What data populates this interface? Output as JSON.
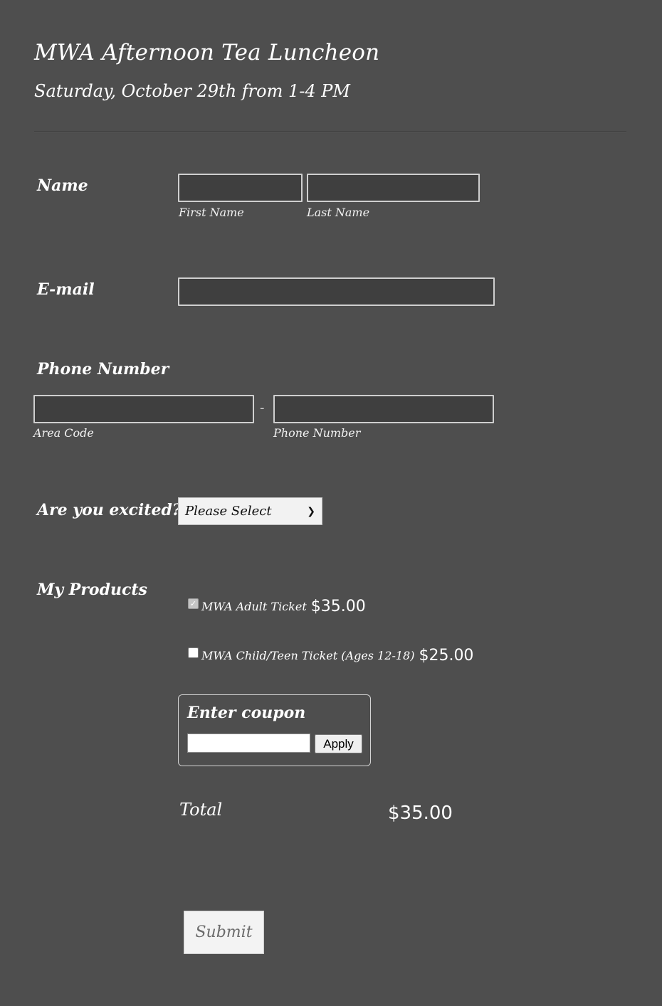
{
  "header": {
    "title": "MWA Afternoon Tea Luncheon",
    "subtitle": "Saturday, October 29th from 1-4 PM"
  },
  "name_field": {
    "label": "Name",
    "first_label": "First Name",
    "last_label": "Last Name",
    "first_value": "",
    "last_value": ""
  },
  "email_field": {
    "label": "E-mail",
    "value": ""
  },
  "phone_field": {
    "label": "Phone Number",
    "area_label": "Area Code",
    "number_label": "Phone Number",
    "separator": "-",
    "area_value": "",
    "number_value": ""
  },
  "excited_field": {
    "label": "Are you excited?",
    "selected": "Please Select"
  },
  "products": {
    "label": "My Products",
    "items": [
      {
        "name": "MWA Adult Ticket",
        "price": "$35.00",
        "checked": true
      },
      {
        "name": "MWA Child/Teen Ticket (Ages 12-18)",
        "price": "$25.00",
        "checked": false
      }
    ],
    "coupon": {
      "label": "Enter coupon",
      "value": "",
      "apply_label": "Apply"
    },
    "total_label": "Total",
    "total_value": "$35.00"
  },
  "submit_label": "Submit"
}
